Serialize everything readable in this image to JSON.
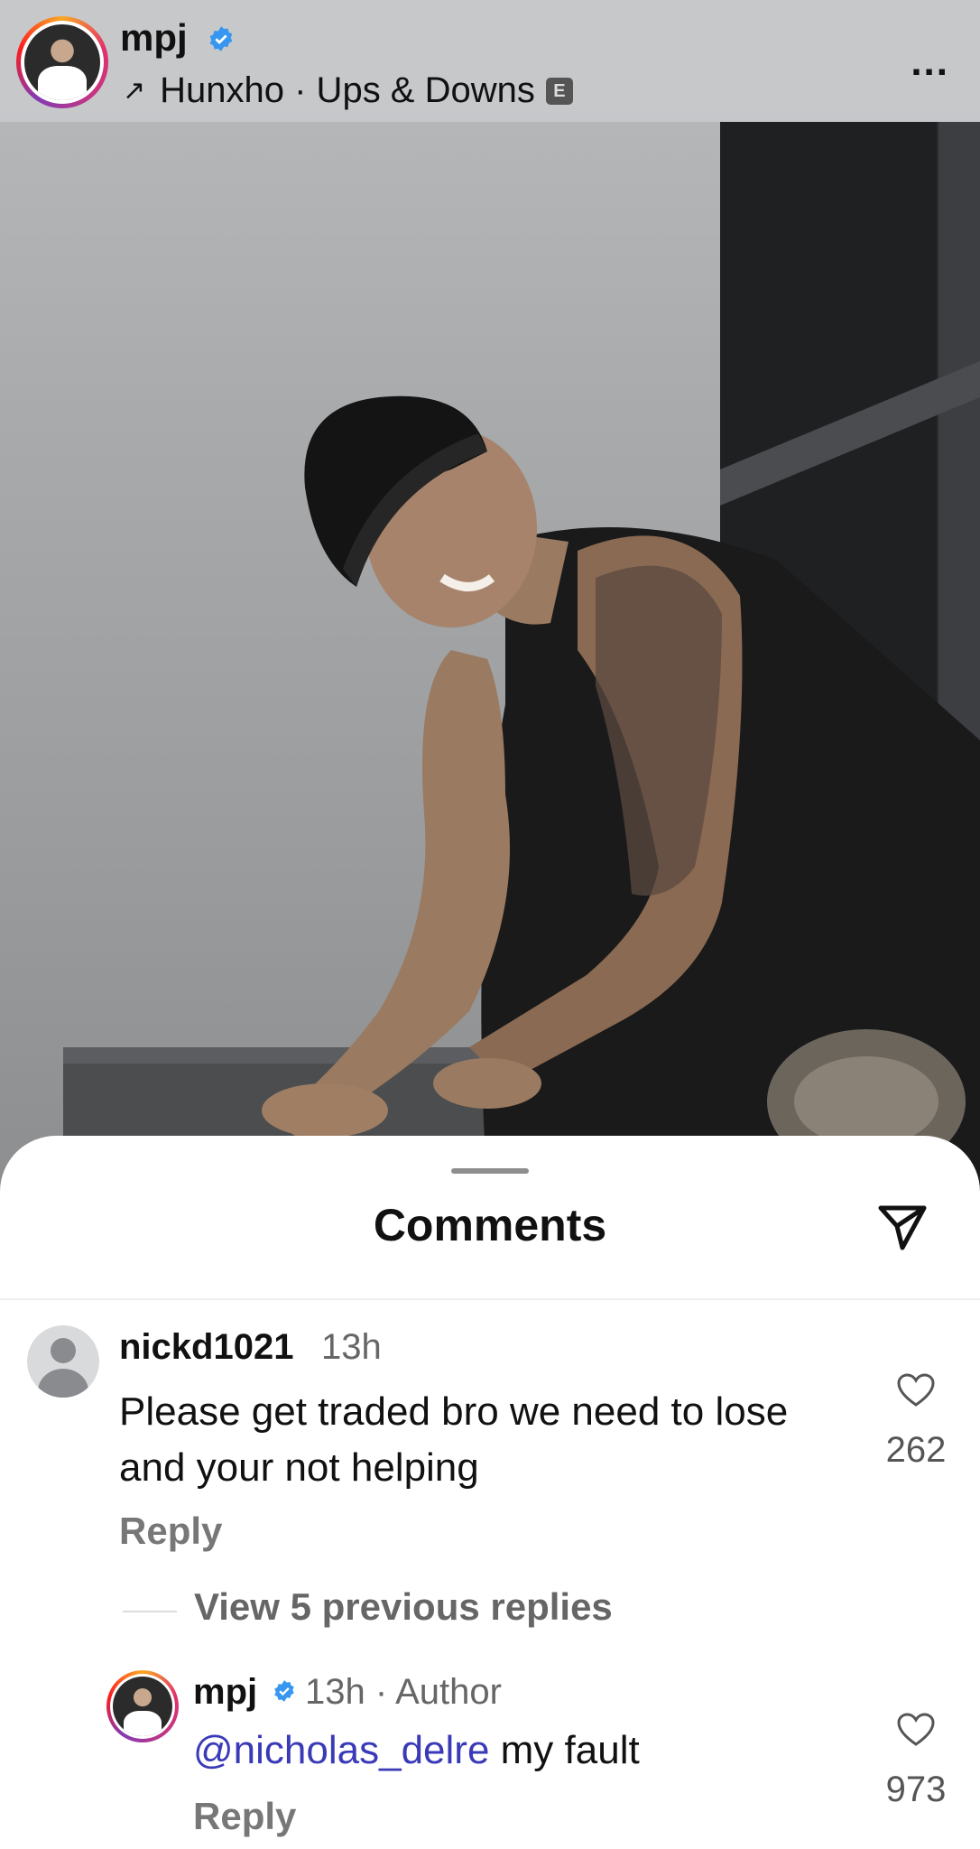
{
  "post_header": {
    "username": "mpj",
    "audio_track": "Hunxho · Ups & Downs",
    "explicit_badge": "E",
    "more_label": "..."
  },
  "comments_sheet": {
    "title": "Comments",
    "comments": [
      {
        "username": "nickd1021",
        "time": "13h",
        "text": "Please get traded bro we need to lose and your not helping",
        "reply_label": "Reply",
        "likes": "262"
      }
    ],
    "view_replies_label": "View 5 previous replies",
    "reply": {
      "username": "mpj",
      "meta": "13h · Author",
      "mention": "@nicholas_delre",
      "text": " my fault",
      "reply_label": "Reply",
      "likes": "973"
    }
  },
  "colors": {
    "verified_blue": "#3797f0",
    "mention_blue": "#3a3ab8"
  }
}
